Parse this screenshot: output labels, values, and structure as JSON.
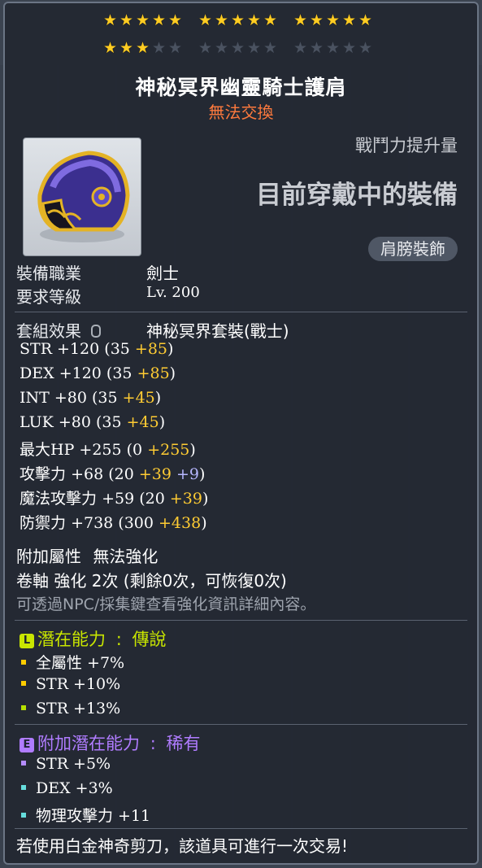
{
  "stars": {
    "groups": [
      [
        true,
        true,
        true,
        true,
        true
      ],
      [
        true,
        true,
        true,
        true,
        true
      ],
      [
        true,
        true,
        true,
        true,
        true
      ],
      [
        true,
        true,
        true,
        false,
        false
      ],
      [
        false,
        false,
        false,
        false,
        false
      ],
      [
        false,
        false,
        false,
        false,
        false
      ]
    ],
    "star_glyph": "★"
  },
  "item": {
    "name": "神秘冥界幽靈騎士護肩",
    "trade_status": "無法交換",
    "icon": "pauldron-icon"
  },
  "combat_power": {
    "label": "戰鬥力提升量",
    "value": "目前穿戴中的裝備"
  },
  "category": "肩膀裝飾",
  "requirements": {
    "job_label": "裝備職業",
    "job_value": "劍士",
    "level_label": "要求等級",
    "level_value": "Lv. 200"
  },
  "set": {
    "label": "套組效果",
    "lock_icon": "lock-icon",
    "value": "神秘冥界套裝(戰士)"
  },
  "stats": [
    {
      "name": "STR",
      "total": "+120",
      "base": "35",
      "bonus": "+85",
      "enh": ""
    },
    {
      "name": "DEX",
      "total": "+120",
      "base": "35",
      "bonus": "+85",
      "enh": ""
    },
    {
      "name": "INT",
      "total": "+80",
      "base": "35",
      "bonus": "+45",
      "enh": ""
    },
    {
      "name": "LUK",
      "total": "+80",
      "base": "35",
      "bonus": "+45",
      "enh": ""
    },
    {
      "name": "最大HP",
      "total": "+255",
      "base": "0",
      "bonus": "+255",
      "enh": ""
    },
    {
      "name": "攻擊力",
      "total": "+68",
      "base": "20",
      "bonus": "+39",
      "enh": "+9"
    },
    {
      "name": "魔法攻擊力",
      "total": "+59",
      "base": "20",
      "bonus": "+39",
      "enh": ""
    },
    {
      "name": "防禦力",
      "total": "+738",
      "base": "300",
      "bonus": "+438",
      "enh": ""
    }
  ],
  "extra": {
    "added_label": "附加屬性",
    "added_value": "無法強化",
    "scroll_text": "卷軸 強化 2次 (剩餘0次，可恢復0次)",
    "hint": "可透過NPC/採集鍵查看強化資訊詳細內容。"
  },
  "potential": {
    "tag": "L",
    "label": "潛在能力",
    "separator": ":",
    "grade": "傳說",
    "color": "#c9e600",
    "lines": [
      "全屬性 +7%",
      "STR +10%",
      "STR +13%"
    ],
    "bullet_colors": [
      "#ffcc00",
      "#ffcc00",
      "#b6e000"
    ]
  },
  "additional_potential": {
    "tag": "E",
    "label": "附加潛在能力",
    "separator": ":",
    "grade": "稀有",
    "color": "#b07cff",
    "lines": [
      "STR +5%",
      "DEX +3%",
      "物理攻擊力 +11"
    ],
    "bullet_colors": [
      "#b58cff",
      "#66dddd",
      "#66dddd"
    ]
  },
  "footer": "若使用白金神奇剪刀，該道具可進行一次交易!"
}
